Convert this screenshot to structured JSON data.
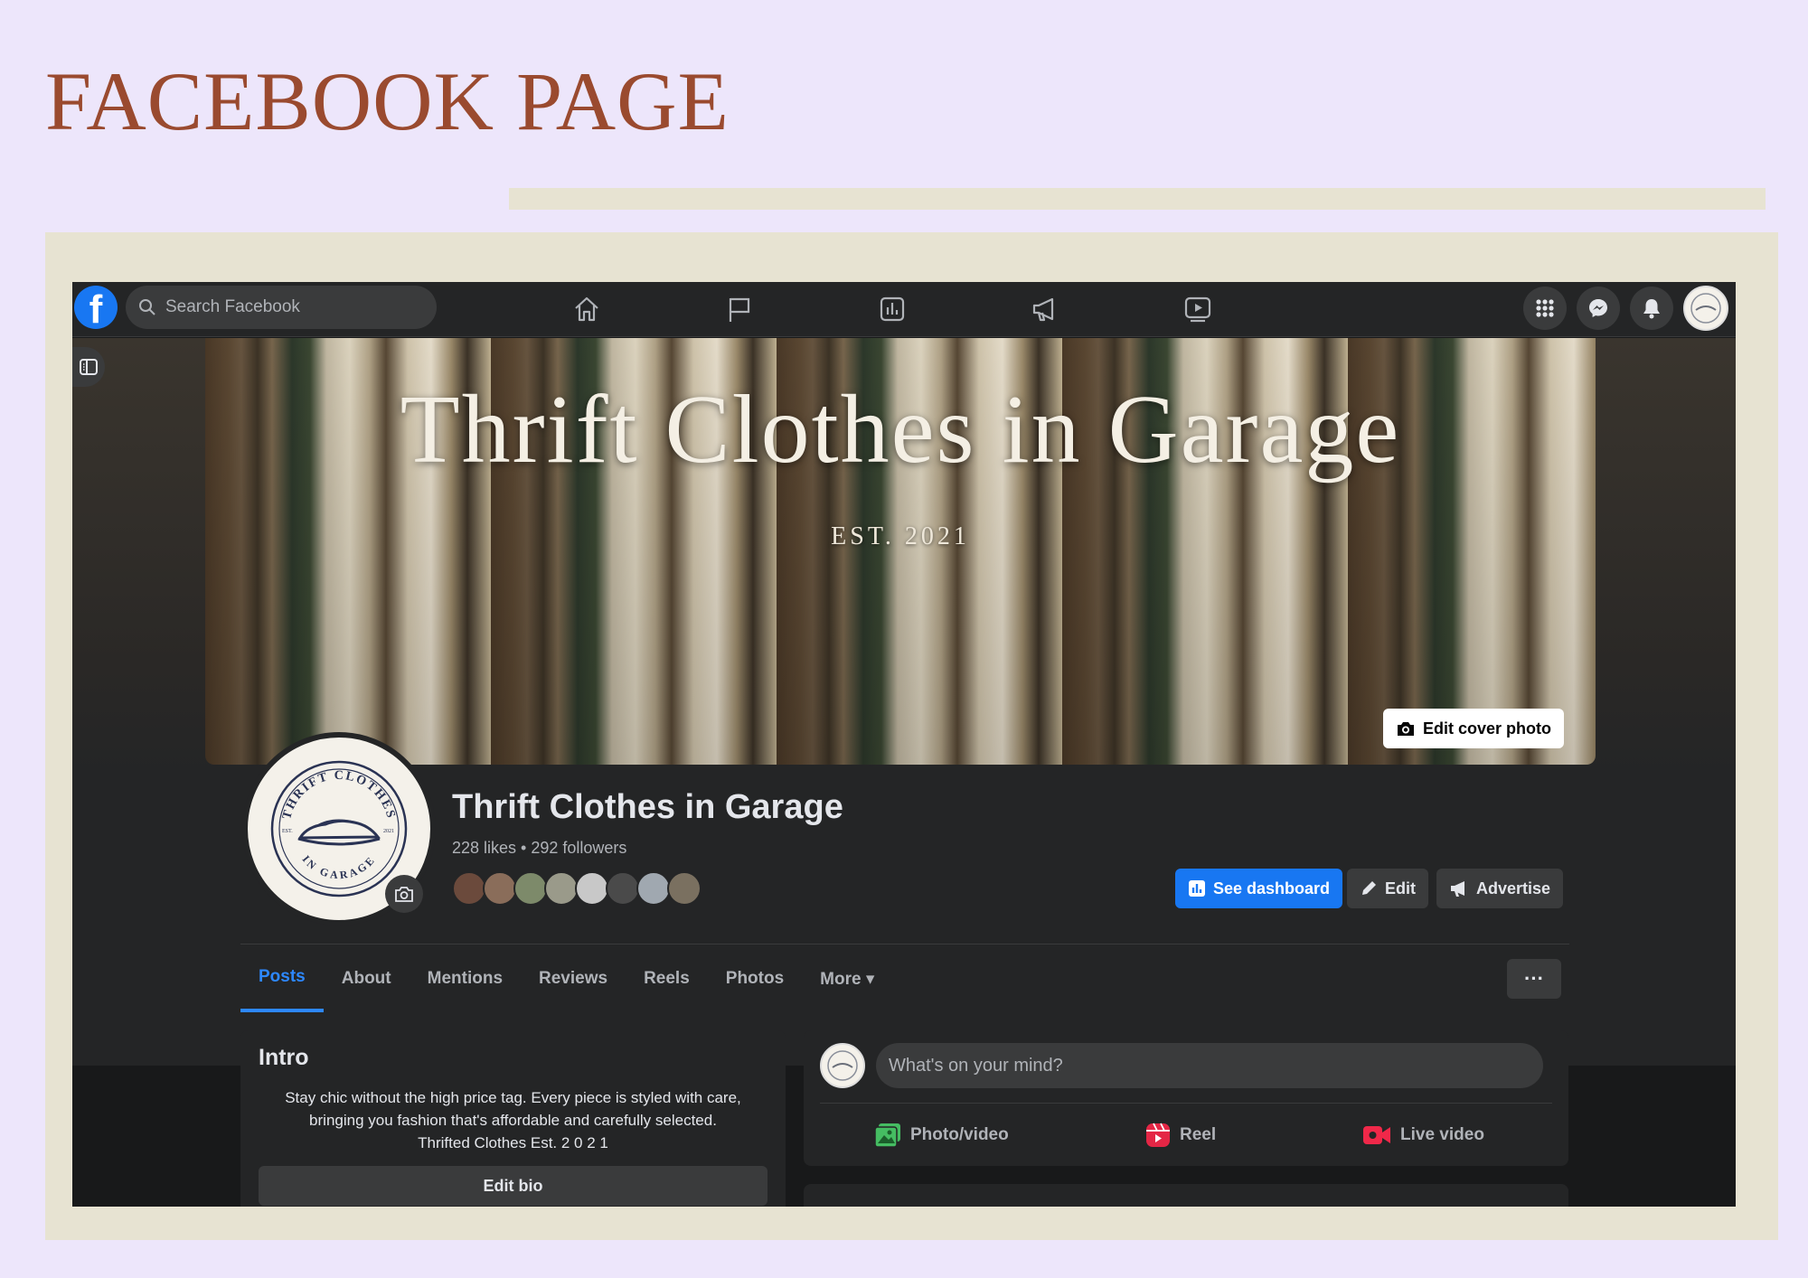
{
  "heading": "FACEBOOK PAGE",
  "topnav": {
    "logo": "f",
    "search_placeholder": "Search Facebook",
    "nav_icons": [
      "home-icon",
      "flag-icon",
      "insights-icon",
      "megaphone-icon",
      "video-icon"
    ],
    "right_icons": [
      "apps-grid-icon",
      "messenger-icon",
      "bell-icon"
    ]
  },
  "cover": {
    "title": "Thrift Clothes in Garage",
    "subtitle": "EST. 2021",
    "edit_label": "Edit cover photo"
  },
  "profile": {
    "name": "Thrift Clothes in Garage",
    "stats": "228 likes • 292 followers",
    "logo_top": "THRIFT CLOTHES",
    "logo_bottom": "IN GARAGE",
    "logo_est": "EST.",
    "logo_year": "2021",
    "follower_colors": [
      "#6b4a3c",
      "#8a6d5a",
      "#7d8a6a",
      "#9a9a8a",
      "#c8c8c8",
      "#4a4a4a",
      "#a0a8b0",
      "#7a7060"
    ]
  },
  "actions": {
    "dashboard": "See dashboard",
    "edit": "Edit",
    "advertise": "Advertise"
  },
  "tabs": [
    {
      "label": "Posts",
      "active": true
    },
    {
      "label": "About"
    },
    {
      "label": "Mentions"
    },
    {
      "label": "Reviews"
    },
    {
      "label": "Reels"
    },
    {
      "label": "Photos"
    },
    {
      "label": "More ▾"
    }
  ],
  "more_menu": "···",
  "intro": {
    "title": "Intro",
    "line1": "Stay chic without the high price tag. Every piece is styled with care,",
    "line2": "bringing you fashion that's affordable and carefully selected.",
    "line3": "Thrifted Clothes Est. 2 0 2 1",
    "edit_bio": "Edit bio"
  },
  "composer": {
    "placeholder": "What's on your mind?",
    "photo_video": "Photo/video",
    "reel": "Reel",
    "live_video": "Live video"
  },
  "colors": {
    "accent": "#1877f2",
    "heading": "#9a4a2f",
    "background": "#ede6fb",
    "frame": "#e7e3d2"
  }
}
